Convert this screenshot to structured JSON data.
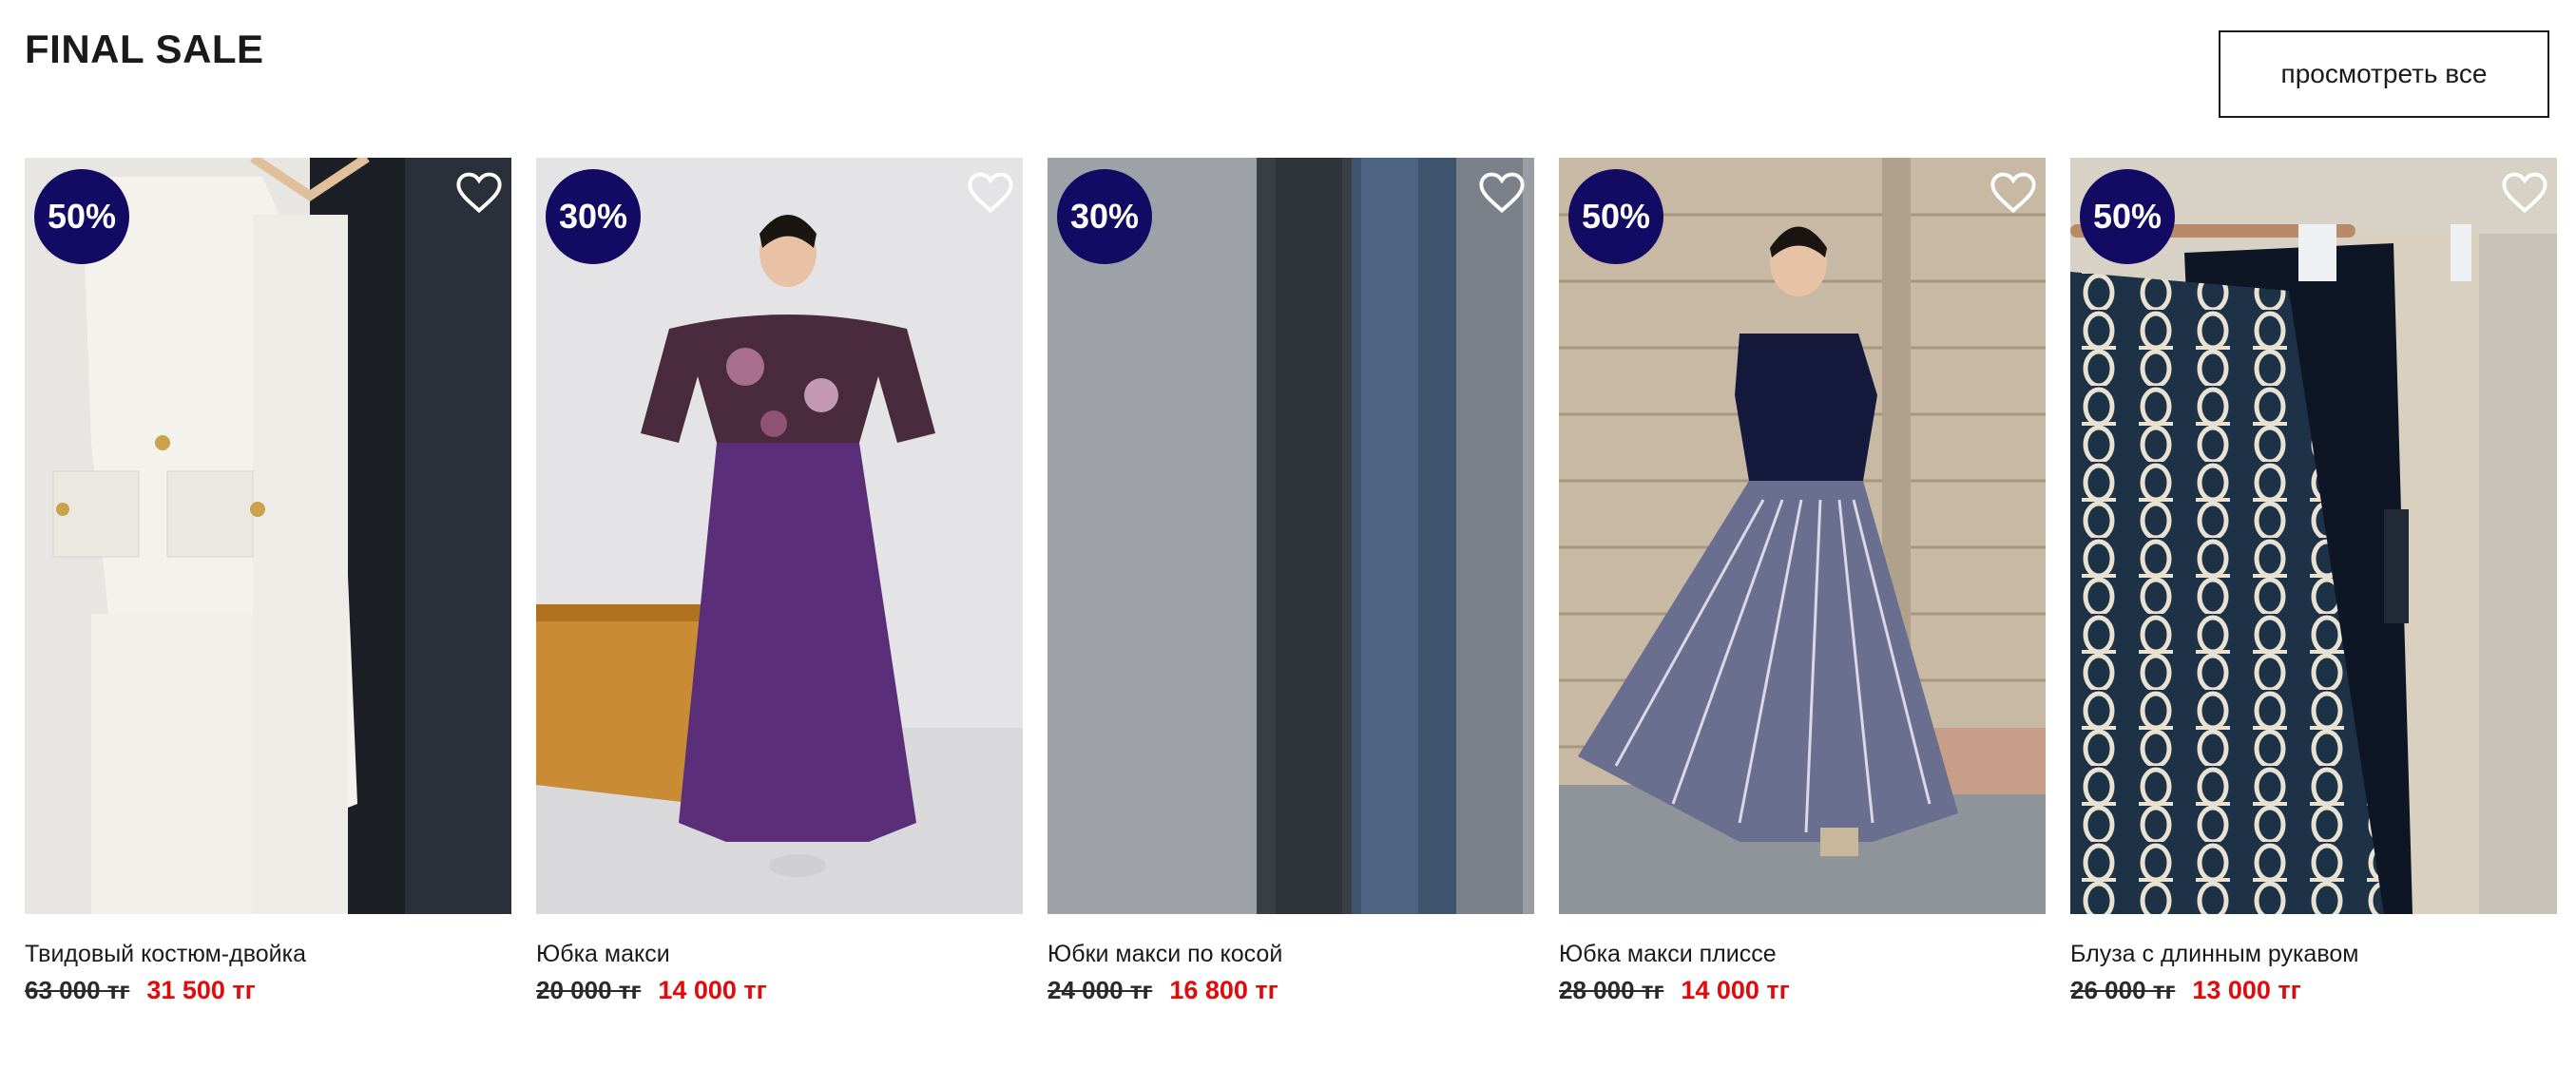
{
  "section": {
    "title": "FINAL SALE",
    "view_all_label": "просмотреть все"
  },
  "products": [
    {
      "name": "Твидовый костюм-двойка",
      "discount": "50%",
      "old_price": "63 000 тг",
      "new_price": "31 500 тг",
      "image": "white tweed jacket and skirt on hangers"
    },
    {
      "name": "Юбка макси",
      "discount": "30%",
      "old_price": "20 000 тг",
      "new_price": "14 000 тг",
      "image": "woman in paisley blouse and purple maxi skirt"
    },
    {
      "name": "Юбки макси по косой",
      "discount": "30%",
      "old_price": "24 000 тг",
      "new_price": "16 800 тг",
      "image": "grey, black and blue fabric skirts"
    },
    {
      "name": "Юбка макси плиссе",
      "discount": "50%",
      "old_price": "28 000 тг",
      "new_price": "14 000 тг",
      "image": "woman in navy top and pleated striped maxi skirt"
    },
    {
      "name": "Блуза с длинным рукавом",
      "discount": "50%",
      "old_price": "26 000 тг",
      "new_price": "13 000 тг",
      "image": "navy blouse with white chain print on hanger"
    }
  ],
  "colors": {
    "badge": "#130a63",
    "sale_price": "#e10b0b",
    "text": "#1a1a1a"
  }
}
